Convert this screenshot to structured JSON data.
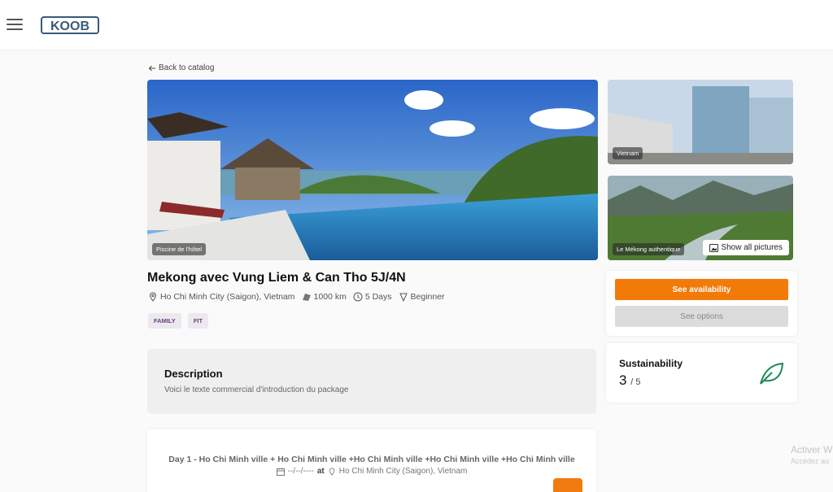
{
  "brand": {
    "logo_text": "KOOB"
  },
  "nav": {
    "back_label": "Back to catalog"
  },
  "gallery": {
    "main_caption": "Piscine de l'hôtel",
    "thumb1_caption": "Vietnam",
    "thumb2_caption": "Le Mékong authentique",
    "show_all_label": "Show all pictures"
  },
  "trip": {
    "title": "Mekong avec Vung Liem & Can Tho 5J/4N",
    "location": "Ho Chi Minh City (Saigon), Vietnam",
    "distance": "1000 km",
    "duration": "5 Days",
    "level": "Beginner",
    "tags": [
      "FAMILY",
      "FIT"
    ]
  },
  "description": {
    "heading": "Description",
    "text": "Voici le texte commercial d'introduction du package"
  },
  "day1": {
    "title": "Day 1 - Ho Chi Minh ville + Ho Chi Minh ville +Ho Chi Minh ville +Ho Chi Minh ville +Ho Chi Minh ville",
    "date": "--/--/----",
    "at": "at",
    "place": "Ho Chi Minh City (Saigon), Vietnam"
  },
  "booking": {
    "availability_label": "See availability",
    "options_label": "See options"
  },
  "sustainability": {
    "label": "Sustainability",
    "score": "3",
    "max": "/ 5"
  },
  "watermark": {
    "line1": "Activer W",
    "line2": "Accédez au"
  },
  "colors": {
    "accent": "#f27a09",
    "tag_bg": "#ece8ef",
    "tag_text": "#6a3e7a",
    "leaf": "#1e8a5a"
  }
}
